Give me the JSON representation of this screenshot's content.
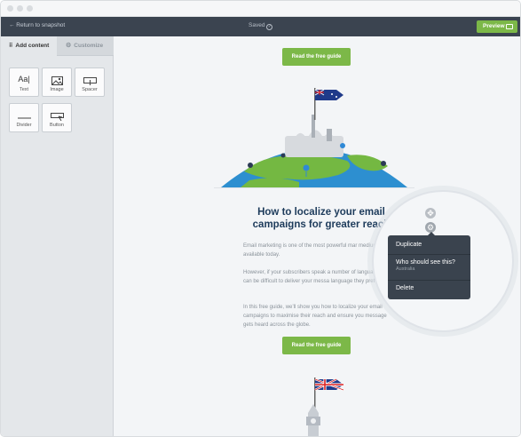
{
  "topbar": {
    "back_label": "← Return to snapshot",
    "saved_label": "Saved",
    "preview_label": "Preview"
  },
  "sidebar": {
    "tabs": [
      {
        "label": "Add content",
        "icon": "grid-icon"
      },
      {
        "label": "Customize",
        "icon": "gear-icon"
      }
    ],
    "blocks": [
      {
        "label": "Text",
        "glyph": "Aa|"
      },
      {
        "label": "Image",
        "icon": "image-icon"
      },
      {
        "label": "Spacer",
        "icon": "spacer-icon"
      },
      {
        "label": "Divider",
        "icon": "divider-icon"
      },
      {
        "label": "Button",
        "icon": "button-icon"
      }
    ]
  },
  "email": {
    "cta_top": "Read the free guide",
    "headline": "How to localize your email campaigns for greater reach",
    "paragraphs": [
      "Email marketing is one of the most powerful mar mediums available today.",
      "However, if your subscribers speak a number of languages it can be difficult to deliver your messa language they prefer.",
      "In this free guide, we’ll show you how to localize your email campaigns to maximise their reach and ensure you message gets heard across the globe."
    ],
    "cta_bottom": "Read the free guide"
  },
  "context_menu": {
    "items": [
      {
        "label": "Duplicate"
      },
      {
        "label": "Who should see this?",
        "sub": "Australia"
      },
      {
        "label": "Delete"
      }
    ]
  },
  "colors": {
    "topbar": "#3b4450",
    "accent_green": "#7cb848",
    "headline": "#1d3b5b",
    "menu": "#3a434e"
  }
}
